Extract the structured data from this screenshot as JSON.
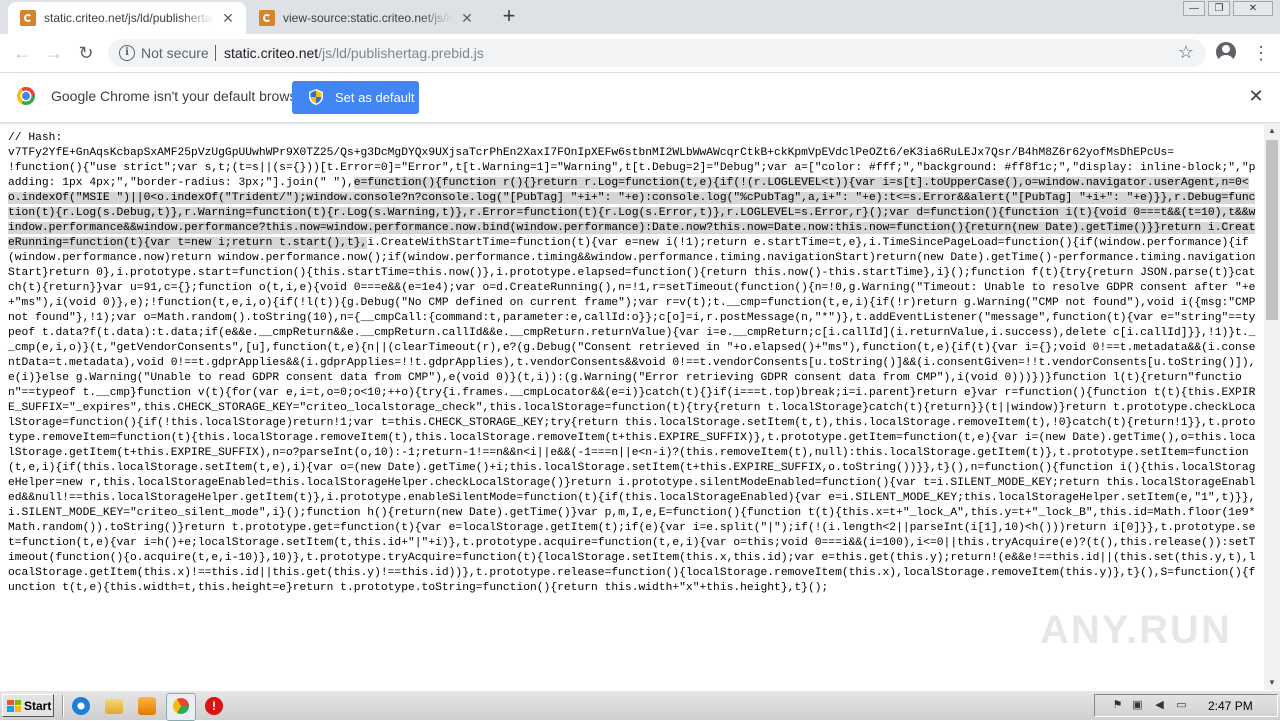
{
  "tabs": [
    {
      "title": "static.criteo.net/js/ld/publishertag.prebid.js",
      "close": "✕"
    },
    {
      "title": "view-source:static.criteo.net/js/ld/publishertag.prebid.js",
      "close": "✕"
    }
  ],
  "new_tab": "+",
  "window_controls": {
    "minimize": "—",
    "restore": "❐",
    "close": "✕"
  },
  "toolbar": {
    "back": "←",
    "forward": "→",
    "reload": "↻",
    "security_text": "Not secure",
    "url_host": "static.criteo.net",
    "url_path": "/js/ld/publishertag.prebid.js",
    "bookmark": "☆",
    "menu": "⋮"
  },
  "infobar": {
    "message": "Google Chrome isn't your default browser",
    "button": "Set as default",
    "close": "✕"
  },
  "source": {
    "pre": "// Hash:\nv7TFy2YfE+GnAqsKcbapSxAMF25pVzUgGpUUwhWPr9X0TZ25/Qs+g3DcMgDYQx9UXjsaTcrPhEn2XaxI7FOnIpXEFw6stbnMI2WLbWwAWcqrCtkB+ckKpmVpEVdclPeOZt6/eK3ia6RuLEJx7Qsr/B4hM8Z6r62yofMsDhEPcUs=\n!function(){\"use strict\";var s,t;(t=s||(s={}))[t.Error=0]=\"Error\",t[t.Warning=1]=\"Warning\",t[t.Debug=2]=\"Debug\";var a=[\"color: #fff;\",\"background: #ff8f1c;\",\"display: inline-block;\",\"padding: 1px 4px;\",\"border-radius: 3px;\"].join(\" \"),",
    "highlight": "e=function(){function r(){}return r.Log=function(t,e){if(!(r.LOGLEVEL<t)){var i=s[t].toUpperCase(),o=window.navigator.userAgent,n=0<o.indexOf(\"MSIE \")||0<o.indexOf(\"Trident/\");window.console?n?console.log(\"[PubTag] \"+i+\": \"+e):console.log(\"%cPubTag\",a,i+\": \"+e):t<=s.Error&&alert(\"[PubTag] \"+i+\": \"+e)}},r.Debug=function(t){r.Log(s.Debug,t)},r.Warning=function(t){r.Log(s.Warning,t)},r.Error=function(t){r.Log(s.Error,t)},r.LOGLEVEL=s.Error,r}();var d=function(){function i(t){void 0===t&&(t=10),t&&window.performance&&window.performance?this.now=window.performance.now.bind(window.performance):Date.now?this.now=Date.now:this.now=function(){return(new Date).getTime()}}return i.CreateRunning=function(t){var t=new i;return t.start(),t},",
    "post": "i.CreateWithStartTime=function(t){var e=new i(!1);return e.startTime=t,e},i.TimeSincePageLoad=function(){if(window.performance){if(window.performance.now)return window.performance.now();if(window.performance.timing&&window.performance.timing.navigationStart)return(new Date).getTime()-performance.timing.navigationStart}return 0},i.prototype.start=function(){this.startTime=this.now()},i.prototype.elapsed=function(){return this.now()-this.startTime},i}();function f(t){try{return JSON.parse(t)}catch(t){return}}var u=91,c={};function o(t,i,e){void 0===e&&(e=1e4);var o=d.CreateRunning(),n=!1,r=setTimeout(function(){n=!0,g.Warning(\"Timeout: Unable to resolve GDPR consent after \"+e+\"ms\"),i(void 0)},e);!function(t,e,i,o){if(!l(t)){g.Debug(\"No CMP defined on current frame\");var r=v(t);t.__cmp=function(t,e,i){if(!r)return g.Warning(\"CMP not found\"),void i({msg:\"CMP not found\"},!1);var o=Math.random().toString(10),n={__cmpCall:{command:t,parameter:e,callId:o}};c[o]=i,r.postMessage(n,\"*\")},t.addEventListener(\"message\",function(t){var e=\"string\"==typeof t.data?f(t.data):t.data;if(e&&e.__cmpReturn&&e.__cmpReturn.callId&&e.__cmpReturn.returnValue){var i=e.__cmpReturn;c[i.callId](i.returnValue,i.success),delete c[i.callId]}},!1)}t.__cmp(e,i,o)}(t,\"getVendorConsents\",[u],function(t,e){n||(clearTimeout(r),e?(g.Debug(\"Consent retrieved in \"+o.elapsed()+\"ms\"),function(t,e){if(t){var i={};void 0!==t.metadata&&(i.consentData=t.metadata),void 0!==t.gdprApplies&&(i.gdprApplies=!!t.gdprApplies),t.vendorConsents&&void 0!==t.vendorConsents[u.toString()]&&(i.consentGiven=!!t.vendorConsents[u.toString()]),e(i)}else g.Warning(\"Unable to read GDPR consent data from CMP\"),e(void 0)}(t,i)):(g.Warning(\"Error retrieving GDPR consent data from CMP\"),i(void 0)))})}function l(t){return\"function\"==typeof t.__cmp}function v(t){for(var e,i=t,o=0;o<10;++o){try{i.frames.__cmpLocator&&(e=i)}catch(t){}if(i===t.top)break;i=i.parent}return e}var r=function(){function t(t){this.EXPIRE_SUFFIX=\"_expires\",this.CHECK_STORAGE_KEY=\"criteo_localstorage_check\",this.localStorage=function(t){try{return t.localStorage}catch(t){return}}(t||window)}return t.prototype.checkLocalStorage=function(){if(!this.localStorage)return!1;var t=this.CHECK_STORAGE_KEY;try{return this.localStorage.setItem(t,t),this.localStorage.removeItem(t),!0}catch(t){return!1}},t.prototype.removeItem=function(t){this.localStorage.removeItem(t),this.localStorage.removeItem(t+this.EXPIRE_SUFFIX)},t.prototype.getItem=function(t,e){var i=(new Date).getTime(),o=this.localStorage.getItem(t+this.EXPIRE_SUFFIX),n=o?parseInt(o,10):-1;return-1!==n&&n<i||e&&(-1===n||e<n-i)?(this.removeItem(t),null):this.localStorage.getItem(t)},t.prototype.setItem=function(t,e,i){if(this.localStorage.setItem(t,e),i){var o=(new Date).getTime()+i;this.localStorage.setItem(t+this.EXPIRE_SUFFIX,o.toString())}},t}(),n=function(){function i(){this.localStorageHelper=new r,this.localStorageEnabled=this.localStorageHelper.checkLocalStorage()}return i.prototype.silentModeEnabled=function(){var t=i.SILENT_MODE_KEY;return this.localStorageEnabled&&null!==this.localStorageHelper.getItem(t)},i.prototype.enableSilentMode=function(t){if(this.localStorageEnabled){var e=i.SILENT_MODE_KEY;this.localStorageHelper.setItem(e,\"1\",t)}},i.SILENT_MODE_KEY=\"criteo_silent_mode\",i}();function h(){return(new Date).getTime()}var p,m,I,e,E=function(){function t(t){this.x=t+\"_lock_A\",this.y=t+\"_lock_B\",this.id=Math.floor(1e9*Math.random()).toString()}return t.prototype.get=function(t){var e=localStorage.getItem(t);if(e){var i=e.split(\"|\");if(!(i.length<2||parseInt(i[1],10)<h()))return i[0]}},t.prototype.set=function(t,e){var i=h()+e;localStorage.setItem(t,this.id+\"|\"+i)},t.prototype.acquire=function(t,e,i){var o=this;void 0===i&&(i=100),i<=0||this.tryAcquire(e)?(t(),this.release()):setTimeout(function(){o.acquire(t,e,i-10)},10)},t.prototype.tryAcquire=function(t){localStorage.setItem(this.x,this.id);var e=this.get(this.y);return!(e&&e!==this.id||(this.set(this.y,t),localStorage.getItem(this.x)!==this.id||this.get(this.y)!==this.id))},t.prototype.release=function(){localStorage.removeItem(this.x),localStorage.removeItem(this.y)},t}(),S=function(){function t(t,e){this.width=t,this.height=e}return t.prototype.toString=function(){return this.width+\"x\"+this.height},t}();"
  },
  "watermark": "ANY.RUN",
  "taskbar": {
    "start": "Start",
    "clock": "2:47 PM"
  }
}
